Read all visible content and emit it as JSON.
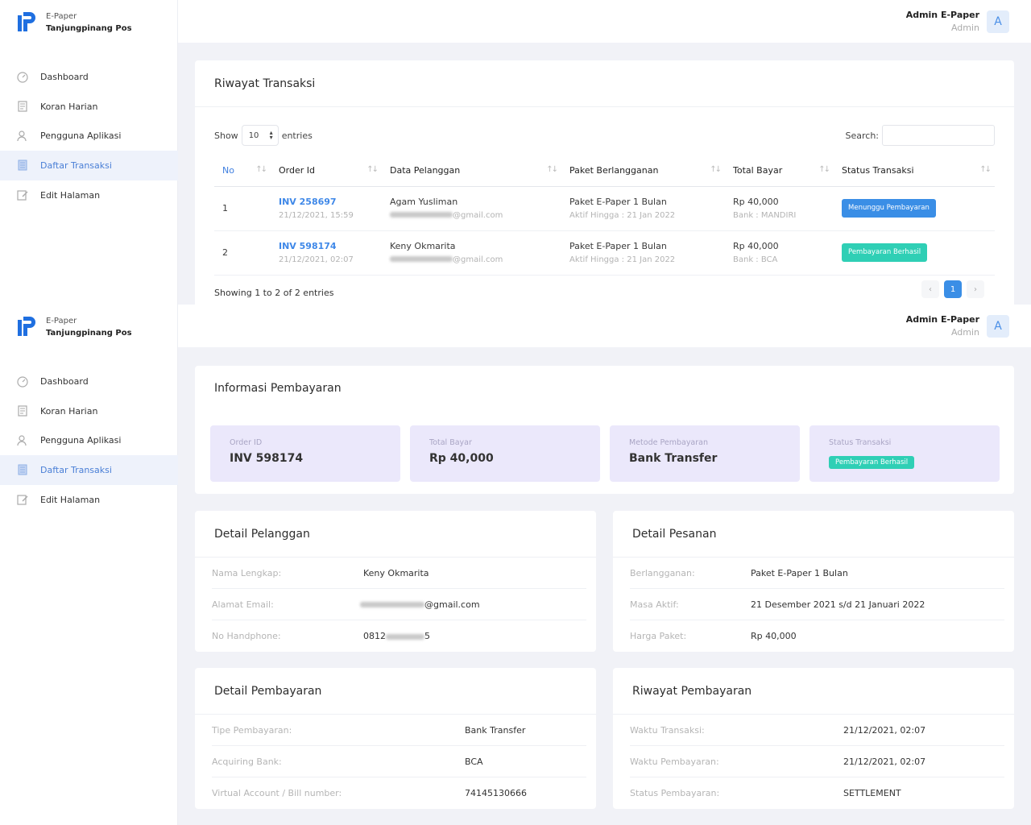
{
  "brand": {
    "line1": "E-Paper",
    "line2": "Tanjungpinang Pos"
  },
  "user": {
    "name": "Admin E-Paper",
    "role": "Admin",
    "avatar_letter": "A"
  },
  "nav": [
    {
      "label": "Dashboard",
      "icon": "dashboard-icon"
    },
    {
      "label": "Koran Harian",
      "icon": "newspaper-icon"
    },
    {
      "label": "Pengguna Aplikasi",
      "icon": "users-icon"
    },
    {
      "label": "Daftar Transaksi",
      "icon": "receipt-icon",
      "active": true
    },
    {
      "label": "Edit Halaman",
      "icon": "edit-icon"
    }
  ],
  "trx": {
    "title": "Riwayat Transaksi",
    "show_label": "Show",
    "entries_value": "10",
    "entries_label": "entries",
    "search_label": "Search:",
    "columns": [
      "No",
      "Order Id",
      "Data Pelanggan",
      "Paket Berlangganan",
      "Total Bayar",
      "Status Transaksi"
    ],
    "rows": [
      {
        "no": "1",
        "order_id": "INV 258697",
        "date": "21/12/2021, 15:59",
        "name": "Agam Yusliman",
        "email_domain": "@gmail.com",
        "paket": "Paket E-Paper 1 Bulan",
        "aktif": "Aktif Hingga : 21 Jan 2022",
        "total": "Rp 40,000",
        "bank": "Bank : MANDIRI",
        "status": "Menunggu Pembayaran"
      },
      {
        "no": "2",
        "order_id": "INV 598174",
        "date": "21/12/2021, 02:07",
        "name": "Keny Okmarita",
        "email_domain": "@gmail.com",
        "paket": "Paket E-Paper 1 Bulan",
        "aktif": "Aktif Hingga : 21 Jan 2022",
        "total": "Rp 40,000",
        "bank": "Bank : BCA",
        "status": "Pembayaran Berhasil"
      }
    ],
    "info": "Showing 1 to 2 of 2 entries",
    "page": "1",
    "prev": "‹",
    "next": "›"
  },
  "info": {
    "title": "Informasi Pembayaran",
    "order_label": "Order ID",
    "order_value": "INV 598174",
    "total_label": "Total Bayar",
    "total_value": "Rp 40,000",
    "method_label": "Metode Pembayaran",
    "method_value": "Bank Transfer",
    "status_label": "Status Transaksi",
    "status_value": "Pembayaran Berhasil"
  },
  "pelanggan": {
    "title": "Detail Pelanggan",
    "rows": [
      {
        "label": "Nama Lengkap:",
        "value": "Keny Okmarita"
      },
      {
        "label": "Alamat Email:",
        "value": "@gmail.com"
      },
      {
        "label": "No Handphone:",
        "value": "0812",
        "suffix": "5"
      }
    ]
  },
  "pesanan": {
    "title": "Detail Pesanan",
    "rows": [
      {
        "label": "Berlangganan:",
        "value": "Paket E-Paper 1 Bulan"
      },
      {
        "label": "Masa Aktif:",
        "value": "21 Desember 2021 s/d 21 Januari 2022"
      },
      {
        "label": "Harga Paket:",
        "value": "Rp 40,000"
      }
    ]
  },
  "pembayaran": {
    "title": "Detail Pembayaran",
    "rows": [
      {
        "label": "Tipe Pembayaran:",
        "value": "Bank Transfer"
      },
      {
        "label": "Acquiring Bank:",
        "value": "BCA"
      },
      {
        "label": "Virtual Account / Bill number:",
        "value": "74145130666"
      }
    ]
  },
  "riwayat": {
    "title": "Riwayat Pembayaran",
    "rows": [
      {
        "label": "Waktu Transaksi:",
        "value": "21/12/2021, 02:07"
      },
      {
        "label": "Waktu Pembayaran:",
        "value": "21/12/2021, 02:07"
      },
      {
        "label": "Status Pembayaran:",
        "value": "SETTLEMENT"
      }
    ]
  },
  "colors": {
    "accent": "#3a8ee6",
    "success": "#2fcfb5",
    "stat_bg": "#ebe8fb"
  }
}
